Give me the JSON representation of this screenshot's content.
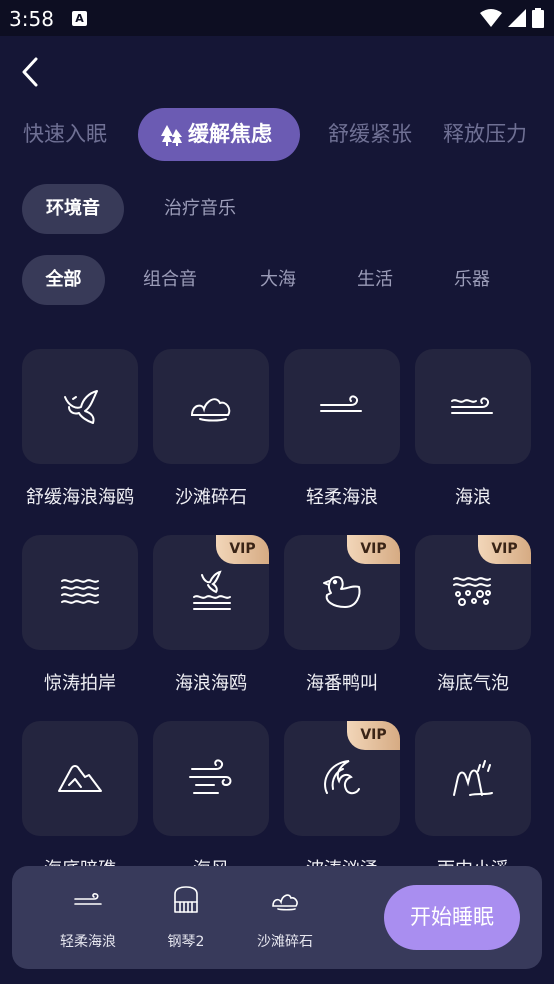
{
  "status_bar": {
    "time": "3:58",
    "notif_letter": "A"
  },
  "tabs": [
    {
      "label": "快速入眠"
    },
    {
      "label": "缓解焦虑"
    },
    {
      "label": "舒缓紧张"
    },
    {
      "label": "释放压力"
    }
  ],
  "sub_tabs": [
    {
      "label": "环境音"
    },
    {
      "label": "治疗音乐"
    }
  ],
  "filters": [
    {
      "label": "全部"
    },
    {
      "label": "组合音"
    },
    {
      "label": "大海"
    },
    {
      "label": "生活"
    },
    {
      "label": "乐器"
    }
  ],
  "vip_label": "VIP",
  "sounds": [
    {
      "label": "舒缓海浪海鸥",
      "icon": "seagull-icon",
      "vip": false
    },
    {
      "label": "沙滩碎石",
      "icon": "stones-icon",
      "vip": false
    },
    {
      "label": "轻柔海浪",
      "icon": "gentle-wave-icon",
      "vip": false
    },
    {
      "label": "海浪",
      "icon": "wave-icon",
      "vip": false
    },
    {
      "label": "惊涛拍岸",
      "icon": "crashing-waves-icon",
      "vip": false
    },
    {
      "label": "海浪海鸥",
      "icon": "seagull-waves-icon",
      "vip": true
    },
    {
      "label": "海番鸭叫",
      "icon": "duck-icon",
      "vip": true
    },
    {
      "label": "海底气泡",
      "icon": "bubbles-icon",
      "vip": true
    },
    {
      "label": "海底暗礁",
      "icon": "reef-icon",
      "vip": false
    },
    {
      "label": "海风",
      "icon": "wind-icon",
      "vip": false
    },
    {
      "label": "波涛汹涌",
      "icon": "rough-sea-icon",
      "vip": true
    },
    {
      "label": "雨中小溪",
      "icon": "rain-stream-icon",
      "vip": false
    }
  ],
  "player": {
    "items": [
      {
        "label": "轻柔海浪",
        "icon": "gentle-wave-icon"
      },
      {
        "label": "钢琴2",
        "icon": "piano-icon"
      },
      {
        "label": "沙滩碎石",
        "icon": "stones-icon"
      }
    ],
    "start_label": "开始睡眠"
  },
  "colors": {
    "background": "#151636",
    "active_tab": "#6b5bb3",
    "tile": "#24253f",
    "player_bar": "#383a5b",
    "start_button": "#a98ef0",
    "vip_gold": "#e3bd98"
  }
}
